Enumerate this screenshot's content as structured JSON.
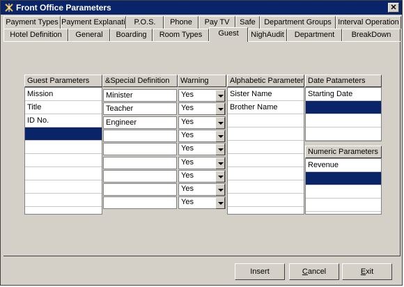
{
  "window": {
    "title": "Front Office Parameters",
    "close_glyph": "✕"
  },
  "tabs_row1": [
    "Payment Types",
    "Payment Explanations",
    "P.O.S.",
    "Phone",
    "Pay TV",
    "Safe",
    "Department Groups",
    "Interval Operation"
  ],
  "tabs_row2": [
    "Hotel Definition",
    "General",
    "Boarding",
    "Room Types",
    "Guest",
    "NighAudit",
    "Department",
    "BreakDown"
  ],
  "active_tab": "Guest",
  "guest_parameters": {
    "header": "Guest Parameters",
    "items": [
      "Mission",
      "Title",
      "ID No."
    ],
    "selected_index": 3
  },
  "special_definition": {
    "header": "&Special Definition",
    "values": [
      "Minister",
      "Teacher",
      "Engineer",
      "",
      "",
      "",
      "",
      "",
      ""
    ]
  },
  "warning": {
    "header": "Warning",
    "values": [
      "Yes",
      "Yes",
      "Yes",
      "Yes",
      "Yes",
      "Yes",
      "Yes",
      "Yes",
      "Yes"
    ]
  },
  "alphabetic_parameters": {
    "header": "Alphabetic Parameters",
    "items": [
      "Sister Name",
      "Brother Name"
    ]
  },
  "date_parameters": {
    "header": "Date Patameters",
    "items": [
      "Starting Date"
    ],
    "selected_index": 1
  },
  "numeric_parameters": {
    "header": "Numeric Parameters",
    "items": [
      "Revenue"
    ],
    "selected_index": 1
  },
  "buttons": {
    "insert": "Insert",
    "cancel_mnemonic": "C",
    "cancel_rest": "ancel",
    "exit_mnemonic": "E",
    "exit_rest": "xit"
  },
  "colors": {
    "selection": "#0a246a",
    "face": "#d4d0c8",
    "titlebar": "#0a246a"
  }
}
